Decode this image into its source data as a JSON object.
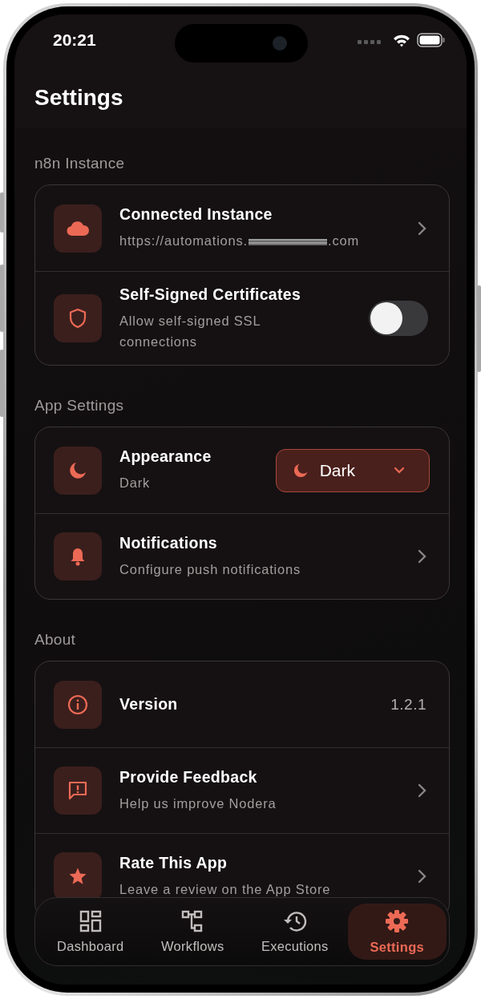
{
  "status_bar": {
    "time": "20:21"
  },
  "header": {
    "title": "Settings"
  },
  "sections": [
    {
      "title": "n8n Instance",
      "rows": [
        {
          "kind": "link",
          "title": "Connected Instance",
          "subtitle_parts": [
            "https://automations.",
            ".com"
          ],
          "redacted": true
        },
        {
          "kind": "toggle",
          "title": "Self-Signed Certificates",
          "subtitle": "Allow self-signed SSL connections",
          "on": false
        }
      ]
    },
    {
      "title": "App Settings",
      "rows": [
        {
          "kind": "select",
          "title": "Appearance",
          "subtitle": "Dark",
          "value": "Dark"
        },
        {
          "kind": "link",
          "title": "Notifications",
          "subtitle": "Configure push notifications"
        }
      ]
    },
    {
      "title": "About",
      "rows": [
        {
          "kind": "value",
          "title": "Version",
          "value": "1.2.1"
        },
        {
          "kind": "link",
          "title": "Provide Feedback",
          "subtitle": "Help us improve Nodera"
        },
        {
          "kind": "link",
          "title": "Rate This App",
          "subtitle": "Leave a review on the App Store"
        }
      ]
    }
  ],
  "tabs": [
    {
      "label": "Dashboard",
      "selected": false
    },
    {
      "label": "Workflows",
      "selected": false
    },
    {
      "label": "Executions",
      "selected": false
    },
    {
      "label": "Settings",
      "selected": true
    }
  ]
}
